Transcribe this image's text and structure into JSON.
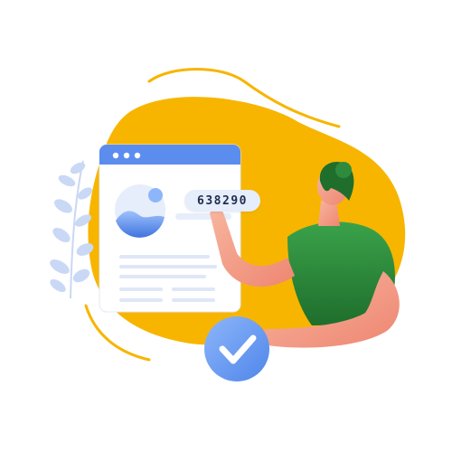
{
  "verification": {
    "code": "638290",
    "status": "verified"
  },
  "icons": {
    "browser": "browser-window-icon",
    "image_placeholder": "image-placeholder-icon",
    "check": "checkmark-icon"
  },
  "colors": {
    "backdrop_blob": "#f7b500",
    "browser_bar": "#5b8def",
    "browser_body": "#ffffff",
    "check_badge": "#6b9cf2",
    "shirt": "#2e8b3d",
    "skin": "#f2a08a",
    "foliage": "#c9d8f5"
  }
}
